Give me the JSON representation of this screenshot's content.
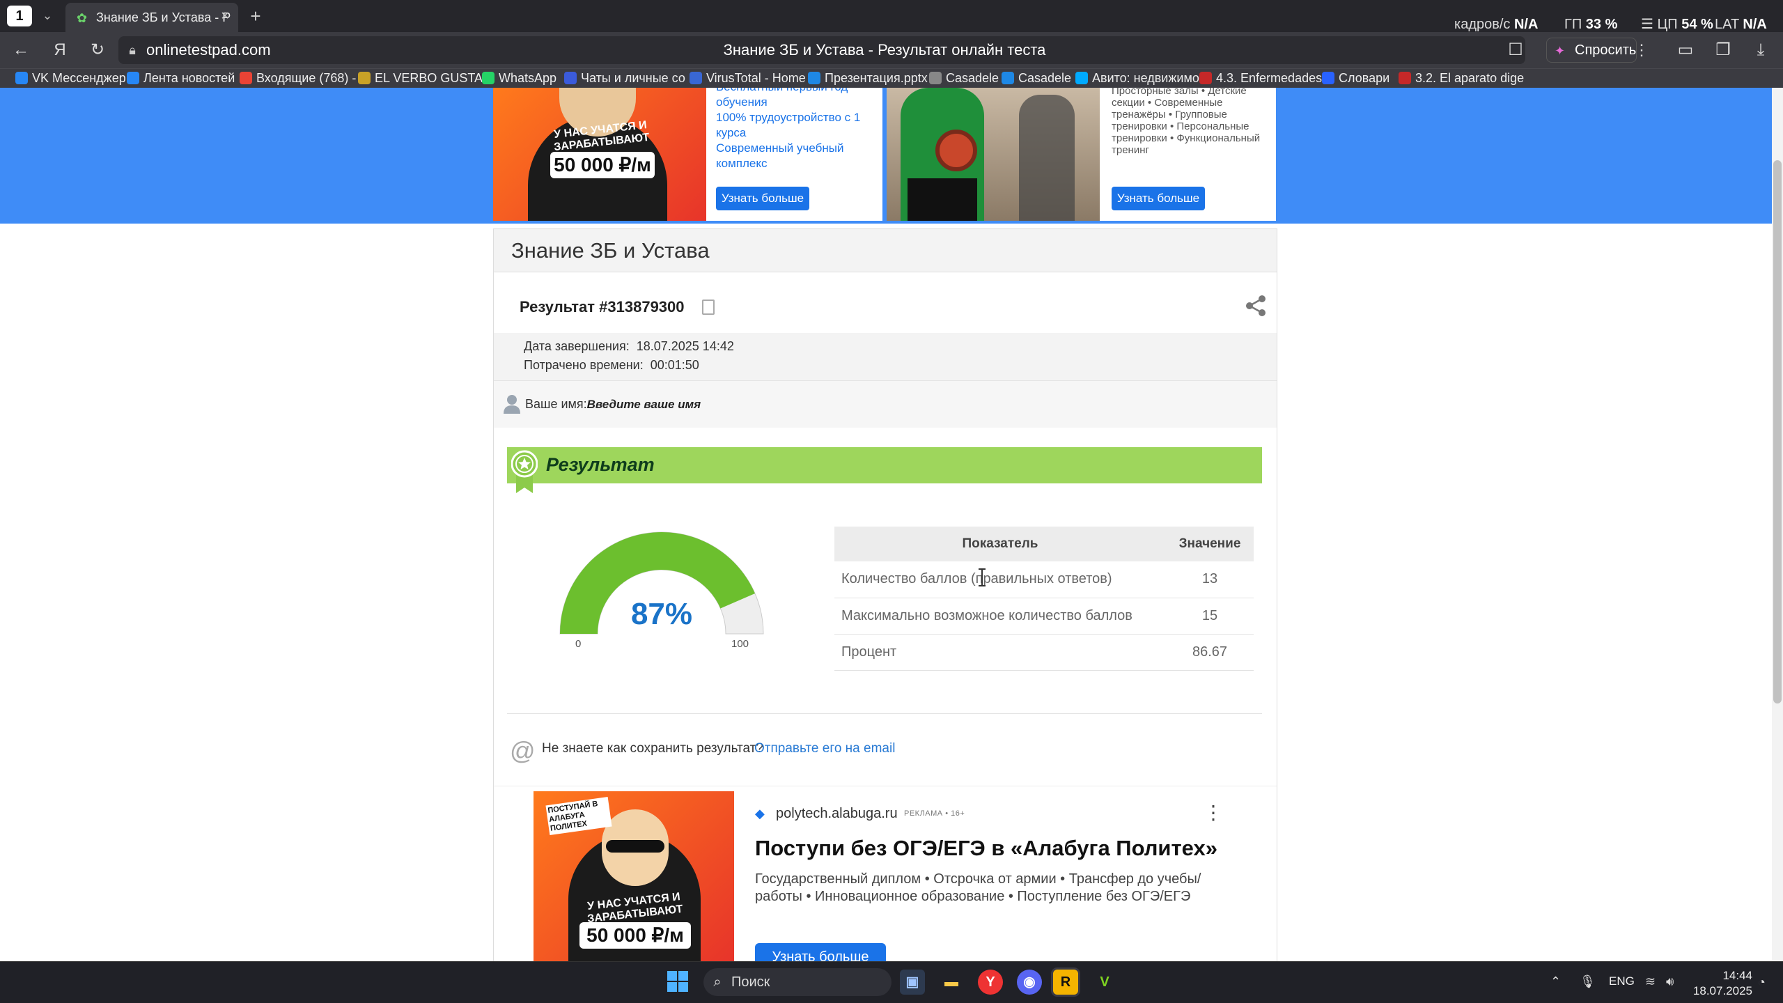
{
  "browser": {
    "tab_counter": "1",
    "tab_title": "Знание ЗБ и Устава - Р",
    "stats": [
      {
        "label": "кадров/с",
        "value": "N/A"
      },
      {
        "label": "ГП",
        "value": "33 %"
      },
      {
        "label": "ЦП",
        "value": "54 %"
      },
      {
        "label": "LAT",
        "value": "N/A"
      }
    ],
    "url": "onlinetestpad.com",
    "page_title": "Знание ЗБ и Устава - Результат онлайн теста",
    "ask_label": "Спросить",
    "bookmarks": [
      {
        "label": "VK Мессенджер",
        "color": "#2787f5"
      },
      {
        "label": "Лента новостей",
        "color": "#2787f5"
      },
      {
        "label": "Входящие (768) -",
        "color": "#ea4335"
      },
      {
        "label": "EL VERBO GUSTA",
        "color": "#c9a227"
      },
      {
        "label": "WhatsApp",
        "color": "#25d366"
      },
      {
        "label": "Чаты и личные со",
        "color": "#3b5bdb"
      },
      {
        "label": "VirusTotal - Home",
        "color": "#3967d4"
      },
      {
        "label": "Презентация.pptx",
        "color": "#1e88e5"
      },
      {
        "label": "Casadele",
        "color": "#888888"
      },
      {
        "label": "Casadele",
        "color": "#1e88e5"
      },
      {
        "label": "Авито: недвижимо",
        "color": "#00aaff"
      },
      {
        "label": "4.3. Enfermedades",
        "color": "#c62828"
      },
      {
        "label": "Словари",
        "color": "#2962ff"
      },
      {
        "label": "3.2. El aparato dige",
        "color": "#c62828"
      }
    ]
  },
  "ad_top": {
    "left": {
      "lines": [
        "Бесплатный первый год",
        "обучения",
        "100% трудоустройство с 1",
        "курса",
        "Современный учебный",
        "комплекс"
      ],
      "img_text": "У НАС УЧАТСЯ И ЗАРАБАТЫВАЮТ",
      "img_amount": "50 000 ₽/м",
      "button": "Узнать больше"
    },
    "right": {
      "lines": [
        "Просторные залы • Детские",
        "секции • Современные",
        "тренажёры • Групповые",
        "тренировки • Персональные",
        "тренировки • Функциональный",
        "тренинг"
      ],
      "button": "Узнать больше"
    }
  },
  "test": {
    "title": "Знание ЗБ и Устава",
    "result_number": "Результат #313879300",
    "finish_label": "Дата завершения:",
    "finish_value": "18.07.2025 14:42",
    "time_label": "Потрачено времени:",
    "time_value": "00:01:50",
    "name_label": "Ваше имя:",
    "name_value": "Введите ваше имя",
    "result_heading": "Результат"
  },
  "gauge": {
    "value_text": "87%",
    "percent": 87,
    "min": "0",
    "max": "100",
    "fill_color": "#6cbf2e",
    "rest_color": "#eeeeee"
  },
  "results_table": {
    "headers": [
      "Показатель",
      "Значение"
    ],
    "rows": [
      {
        "label": "Количество баллов (правильных ответов)",
        "value": "13"
      },
      {
        "label": "Максимально возможное количество баллов",
        "value": "15"
      },
      {
        "label": "Процент",
        "value": "86.67"
      }
    ]
  },
  "save": {
    "question": "Не знаете как сохранить результат?",
    "link": "Отправьте его на email"
  },
  "ad_bottom": {
    "domain": "polytech.alabuga.ru",
    "tag": "РЕКЛАМА • 16+",
    "title": "Поступи без ОГЭ/ЕГЭ в «Алабуга Политех»",
    "description": "Государственный диплом • Отсрочка от армии • Трансфер до учебы/работы • Инновационное образование • Поступление без ОГЭ/ЕГЭ",
    "img_top": "ПОСТУПАЙ В АЛАБУГА ПОЛИТЕХ",
    "img_text": "У НАС УЧАТСЯ И ЗАРАБАТЫВАЮТ",
    "img_amount": "50 000 ₽/м",
    "button": "Узнать больше"
  },
  "taskbar": {
    "search_placeholder": "Поиск",
    "lang": "ENG",
    "time": "14:44",
    "date": "18.07.2025"
  }
}
